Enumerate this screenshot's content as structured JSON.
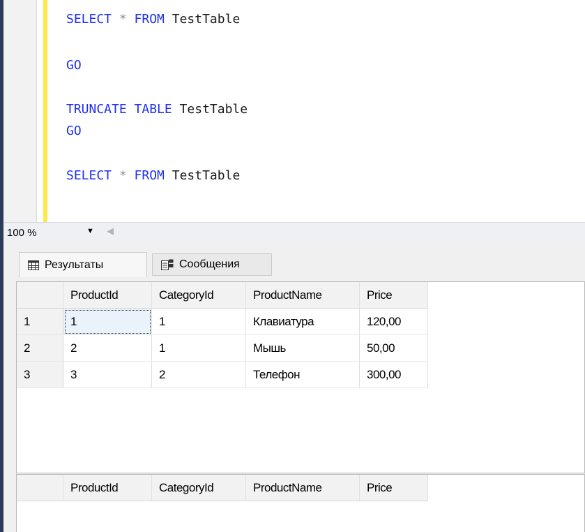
{
  "editor": {
    "lines": [
      {
        "kw1": "SELECT",
        "op": " * ",
        "kw2": "FROM",
        "rest": " TestTable"
      },
      {
        "kw1": "GO"
      },
      {
        "kw1": "TRUNCATE TABLE",
        "rest": " TestTable"
      },
      {
        "kw1": "GO"
      },
      {
        "kw1": "SELECT",
        "op": " * ",
        "kw2": "FROM",
        "rest": " TestTable"
      }
    ],
    "keyword_color": "#1f2ff5",
    "change_bar_color": "#ffe84d"
  },
  "zoom": {
    "value": "100 %",
    "arrow_icon": "chevron-down-icon"
  },
  "tabs": [
    {
      "label": "Результаты",
      "icon": "grid-icon",
      "active": true
    },
    {
      "label": "Сообщения",
      "icon": "messages-icon",
      "active": false
    }
  ],
  "result_grid_1": {
    "columns": [
      "ProductId",
      "CategoryId",
      "ProductName",
      "Price"
    ],
    "rows": [
      {
        "num": "1",
        "cells": [
          "1",
          "1",
          "Клавиатура",
          "120,00"
        ]
      },
      {
        "num": "2",
        "cells": [
          "2",
          "1",
          "Мышь",
          "50,00"
        ]
      },
      {
        "num": "3",
        "cells": [
          "3",
          "2",
          "Телефон",
          "300,00"
        ]
      }
    ]
  },
  "result_grid_2": {
    "columns": [
      "ProductId",
      "CategoryId",
      "ProductName",
      "Price"
    ]
  }
}
